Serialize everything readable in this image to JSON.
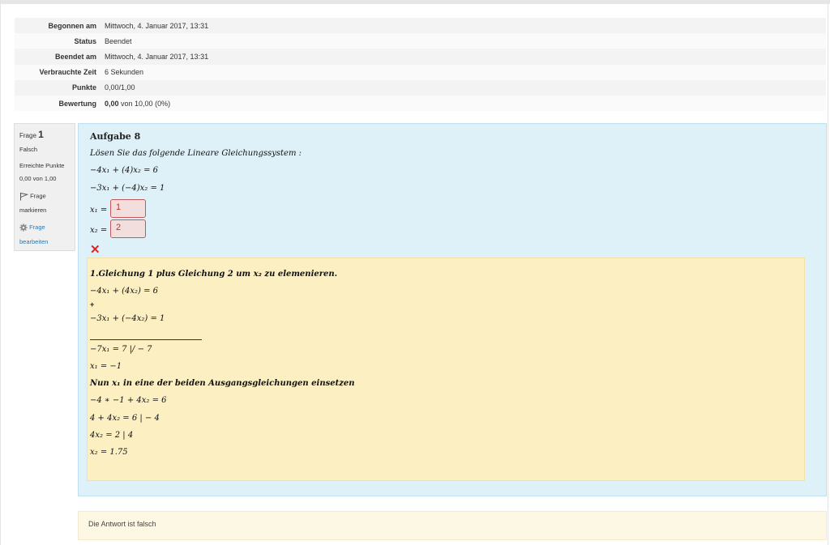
{
  "summary": [
    {
      "label": "Begonnen am",
      "value": "Mittwoch, 4. Januar 2017, 13:31"
    },
    {
      "label": "Status",
      "value": "Beendet"
    },
    {
      "label": "Beendet am",
      "value": "Mittwoch, 4. Januar 2017, 13:31"
    },
    {
      "label": "Verbrauchte Zeit",
      "value": "6 Sekunden"
    },
    {
      "label": "Punkte",
      "value": "0,00/1,00"
    },
    {
      "label": "Bewertung",
      "value_bold": "0,00",
      "value_rest": " von 10,00 (0%)"
    }
  ],
  "question_info": {
    "prefix": "Frage ",
    "number": "1",
    "state": "Falsch",
    "grade_label": "Erreichte Punkte",
    "grade_value": "0,00 von 1,00",
    "flag_label_1": "Frage",
    "flag_label_2": "markieren",
    "edit_label_1": "Frage",
    "edit_label_2": "bearbeiten",
    "icons": {
      "flag": "flag-icon",
      "edit": "gear-icon"
    }
  },
  "question": {
    "title": "Aufgabe 8",
    "prompt": "Lösen Sie das folgende Lineare Gleichungssystem :",
    "eq1": "−4x₁ + (4)x₂ = 6",
    "eq2": "−3x₁ + (−4)x₂ = 1",
    "x1_label": "x₁ =",
    "x2_label": "x₂ =",
    "x1_answer": "1",
    "x2_answer": "2",
    "result_icon": "cross-icon",
    "result_color": "#e02424"
  },
  "feedback": {
    "step1": "1.Gleichung 1 plus Gleichung 2 um x₂ zu elemenieren.",
    "line1": "−4x₁ + (4x₂) = 6",
    "plus": "+",
    "line2": "−3x₁ + (−4x₂) = 1",
    "line3": "−7x₁ = 7 |/ − 7",
    "line4": "x₁ = −1",
    "step2": "Nun x₁ in eine der beiden Ausgangsgleichungen einsetzen",
    "line5": "−4 ∗ −1 + 4x₂ = 6",
    "line6": "4 + 4x₂ = 6 | − 4",
    "line7": "4x₂ = 2 | 4",
    "line8": "x₂ = 1.75"
  },
  "final_feedback": "Die Antwort ist falsch",
  "colors": {
    "formulation_bg": "#def0f8",
    "feedback_bg": "#fcefc2",
    "wrong_bg": "#f3dede",
    "link": "#2a7ab0"
  }
}
